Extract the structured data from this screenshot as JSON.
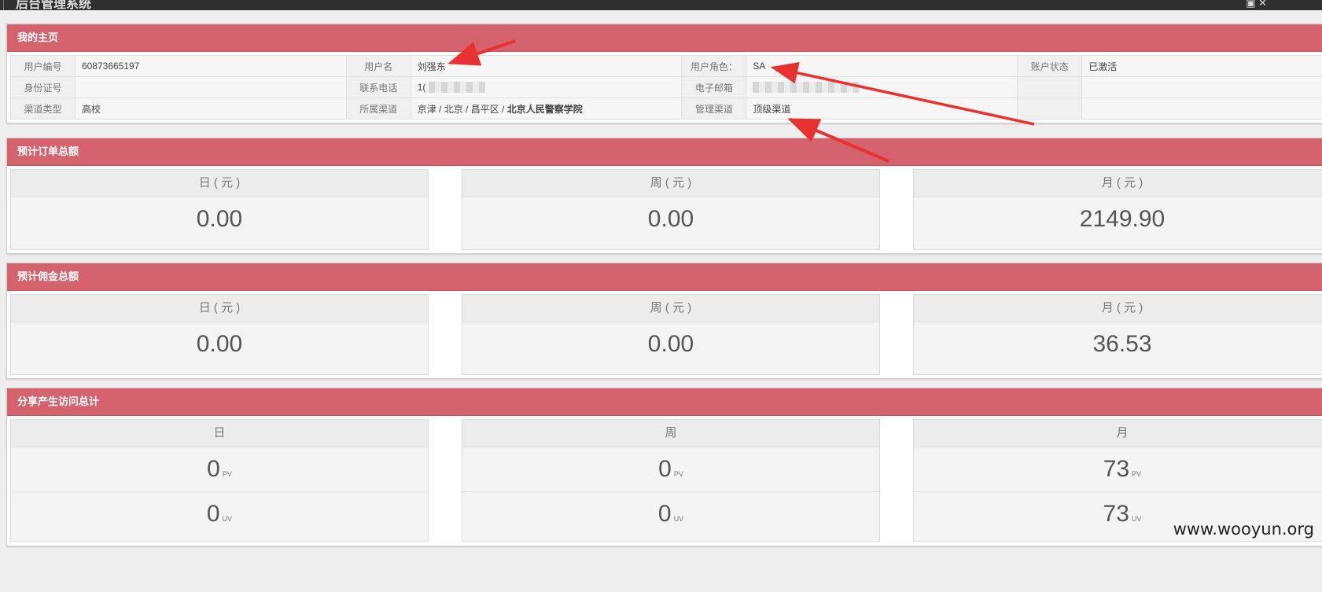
{
  "window": {
    "title": "后台管理系统",
    "icons": "▣ ✕"
  },
  "profile": {
    "title": "我的主页",
    "rows": [
      [
        {
          "label": "用户编号",
          "value": "60873665197"
        },
        {
          "label": "用户名",
          "value": "刘强东"
        },
        {
          "label": "用户角色：",
          "value": "SA"
        },
        {
          "label": "账户状态",
          "value": "已激活"
        }
      ],
      [
        {
          "label": "身份证号",
          "value": ""
        },
        {
          "label": "联系电话",
          "value": "1("
        },
        {
          "label": "电子邮箱",
          "value": ""
        },
        {
          "label": "",
          "value": ""
        }
      ],
      [
        {
          "label": "渠道类型",
          "value": "高校"
        },
        {
          "label": "所属渠道",
          "value": "京津 / 北京 / 昌平区 / ",
          "value_bold": "北京人民警察学院"
        },
        {
          "label": "管理渠道",
          "value": "顶级渠道"
        },
        {
          "label": "",
          "value": ""
        }
      ]
    ]
  },
  "orders": {
    "title": "预计订单总额",
    "cells": [
      {
        "label": "日 ( 元 )",
        "value": "0.00"
      },
      {
        "label": "周 ( 元 )",
        "value": "0.00"
      },
      {
        "label": "月 ( 元 )",
        "value": "2149.90"
      }
    ]
  },
  "commission": {
    "title": "预计佣金总额",
    "cells": [
      {
        "label": "日 ( 元 )",
        "value": "0.00"
      },
      {
        "label": "周 ( 元 )",
        "value": "0.00"
      },
      {
        "label": "月 ( 元 )",
        "value": "36.53"
      }
    ]
  },
  "visits": {
    "title": "分享产生访问总计",
    "cells": [
      {
        "label": "日",
        "pv": "0",
        "pv_unit": "PV",
        "uv": "0",
        "uv_unit": "UV"
      },
      {
        "label": "周",
        "pv": "0",
        "pv_unit": "PV",
        "uv": "0",
        "uv_unit": "UV"
      },
      {
        "label": "月",
        "pv": "73",
        "pv_unit": "PV",
        "uv": "73",
        "uv_unit": "UV"
      }
    ]
  },
  "watermark": "www.wooyun.org",
  "colors": {
    "header_red": "#d4636e",
    "annotation_arrow": "#e8322f"
  }
}
